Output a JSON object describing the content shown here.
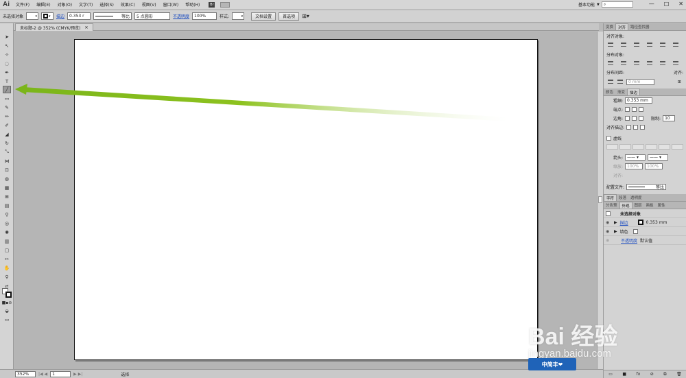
{
  "app": {
    "logo": "Ai"
  },
  "menu": [
    "文件(F)",
    "编辑(E)",
    "对象(O)",
    "文字(T)",
    "选择(S)",
    "效果(C)",
    "视图(V)",
    "窗口(W)",
    "帮助(H)"
  ],
  "workspace": {
    "label": "基本功能",
    "search_placeholder": ""
  },
  "window_buttons": [
    "—",
    "□",
    "✕"
  ],
  "control": {
    "selection": "未选择对象",
    "stroke_link": "描边",
    "stroke_weight": "0.353 r",
    "profile": "等比",
    "brush": "5 点圆形",
    "opacity_link": "不透明度",
    "opacity_value": "100%",
    "style_label": "样式:",
    "doc_setup": "文档设置",
    "preferences": "首选项"
  },
  "doc_tab": {
    "title": "未标题-2 @ 352% (CMYK/预览)",
    "close": "✕"
  },
  "status": {
    "zoom": "352%",
    "page": "1",
    "mode": "选择"
  },
  "panels": {
    "group1_tabs": [
      "变换",
      "对齐",
      "路径查找器"
    ],
    "align_objects": "对齐对象:",
    "distribute_objects": "分布对象:",
    "distribute_spacing": "分布间距:",
    "align_to": "对齐:",
    "spacing_value": "0 mm",
    "group2_tabs": [
      "颜色",
      "渐变",
      "描边"
    ],
    "weight_label": "粗细:",
    "weight_value": "0.353 mm",
    "cap_label": "端点:",
    "corner_label": "边角:",
    "limit_label": "限制:",
    "limit_value": "10",
    "align_stroke_label": "对齐描边:",
    "dashed_label": "虚线",
    "arrow_label": "箭头:",
    "scale_label": "缩放:",
    "scale_value1": "100%",
    "scale_value2": "100%",
    "align_label": "对齐:",
    "profile_label": "配置文件:",
    "profile_value": "等比",
    "group3_tabs": [
      "字符",
      "段落",
      "透明度"
    ],
    "group4_tabs": [
      "分色预",
      "外观",
      "图层",
      "画板",
      "属性"
    ],
    "appearance_title": "未选择对象",
    "stroke_row": "描边",
    "stroke_row_value": "0.353 mm",
    "fill_row": "填色",
    "opacity_row": "不透明度",
    "opacity_row_value": "默认值"
  },
  "watermark": {
    "main": "Bai 经验",
    "sub": "jingyan.baidu.com",
    "badge": "中简丰❤"
  },
  "colors": {
    "arrow": "#8dc21f",
    "watermark_badge": "#1f63b8"
  }
}
